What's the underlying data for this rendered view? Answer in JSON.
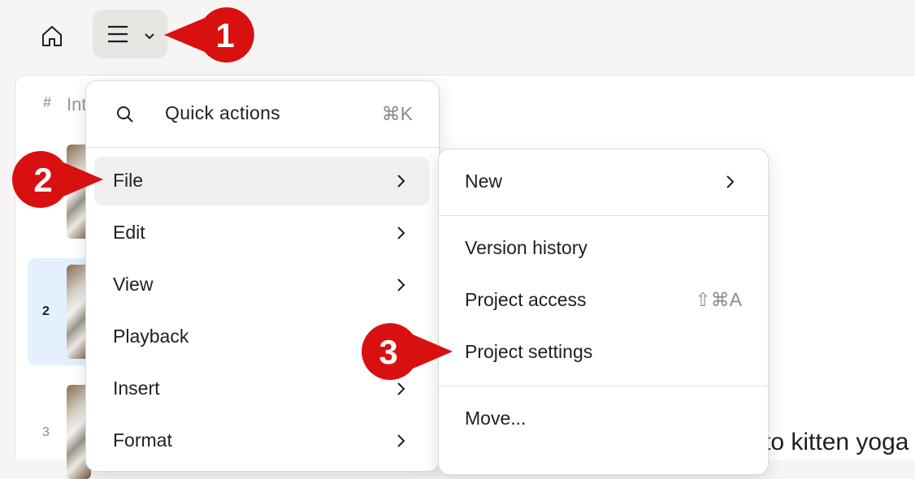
{
  "topbar": {
    "home_icon": "home-icon",
    "menu_icon": "hamburger-icon",
    "menu_chevron": "chevron-down-icon"
  },
  "scene_list": {
    "hash": "#",
    "title": "Int",
    "rows": [
      {
        "number": "2",
        "selected": true
      },
      {
        "number": "3",
        "selected": false
      }
    ]
  },
  "background_text": "to kitten yoga",
  "main_menu": {
    "quick_actions": {
      "label": "Quick actions",
      "shortcut": "⌘K",
      "icon": "search-icon"
    },
    "items": [
      {
        "label": "File",
        "highlighted": true
      },
      {
        "label": "Edit"
      },
      {
        "label": "View"
      },
      {
        "label": "Playback"
      },
      {
        "label": "Insert"
      },
      {
        "label": "Format"
      }
    ]
  },
  "file_submenu": {
    "items": [
      {
        "label": "New",
        "has_submenu": true
      },
      {
        "label": "Version history"
      },
      {
        "label": "Project access",
        "shortcut": "⇧⌘A"
      },
      {
        "label": "Project settings"
      },
      {
        "label": "Move..."
      }
    ]
  },
  "callouts": [
    "1",
    "2",
    "3"
  ],
  "colors": {
    "callout": "#d91010",
    "selection": "#e2f1fd",
    "highlight": "#efefef"
  }
}
